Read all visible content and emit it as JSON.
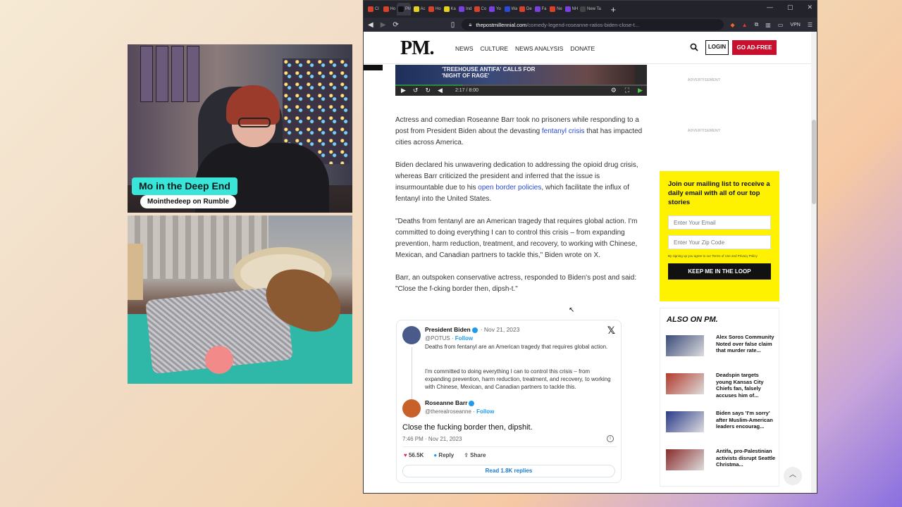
{
  "overlay": {
    "streamer_name": "Mo in the Deep End",
    "platform_tag": "Mointhedeep on Rumble"
  },
  "browser": {
    "tabs": [
      {
        "label": "Cl",
        "color": "#d9412b"
      },
      {
        "label": "Ho",
        "color": "#d9412b"
      },
      {
        "label": "PM",
        "color": "#111111",
        "active": true
      },
      {
        "label": "Ac",
        "color": "#e6d21a"
      },
      {
        "label": "Ho",
        "color": "#d9412b"
      },
      {
        "label": "Ka",
        "color": "#e6d21a"
      },
      {
        "label": "Ind",
        "color": "#7b3fe4"
      },
      {
        "label": "Co",
        "color": "#d9412b"
      },
      {
        "label": "Yo",
        "color": "#7b3fe4"
      },
      {
        "label": "Wa",
        "color": "#2a4bd8"
      },
      {
        "label": "De",
        "color": "#d9412b"
      },
      {
        "label": "Fa",
        "color": "#7b3fe4"
      },
      {
        "label": "Ne",
        "color": "#d9412b"
      },
      {
        "label": "NH",
        "color": "#7b3fe4"
      },
      {
        "label": "New Ta",
        "color": "#444444"
      }
    ],
    "new_tab": "+",
    "url_domain": "thepostmillennial.com",
    "url_path": "/comedy-legend-roseanne-ratios-biden-close-t...",
    "vpn": "VPN"
  },
  "site": {
    "logo": "PM.",
    "menu": [
      "NEWS",
      "CULTURE",
      "NEWS ANALYSIS",
      "DONATE"
    ],
    "login": "LOGIN",
    "adfree": "GO AD-FREE",
    "video": {
      "title_line1": "'TREEHOUSE ANTIFA' CALLS FOR",
      "title_line2": "'NIGHT OF RAGE'",
      "time": "2:17 / 8:00",
      "progress": 0.27
    },
    "article": {
      "p1_a": "Actress and comedian Roseanne Barr took no prisoners while responding to a post from President Biden about the devasting ",
      "p1_link": "fentanyl crisis",
      "p1_b": " that has impacted cities across America.",
      "p2_a": "Biden declared his unwavering dedication to addressing the opioid drug crisis, whereas Barr criticized the president and inferred that the issue is insurmountable due to his ",
      "p2_link": "open border policies",
      "p2_b": ", which facilitate the influx of fentanyl into the United States.",
      "p3": "\"Deaths from fentanyl are an American tragedy that requires global action. I'm committed to doing everything I can to control this crisis – from expanding prevention, harm reduction, treatment, and recovery, to working with Chinese, Mexican, and Canadian partners to tackle this,\" Biden wrote on X.",
      "p4": "Barr, an outspoken conservative actress, responded to Biden's post and said: \"Close the f-cking border then, dipsh-t.\""
    },
    "tweet": {
      "q_name": "President Biden",
      "q_date": "· Nov 21, 2023",
      "q_handle": "@POTUS · ",
      "q_follow": "Follow",
      "q_text1": "Deaths from fentanyl are an American tragedy that requires global action.",
      "q_text2": "I'm committed to doing everything I can to control this crisis – from expanding prevention, harm reduction, treatment, and recovery, to working with Chinese, Mexican, and Canadian partners to tackle this.",
      "r_name": "Roseanne Barr",
      "r_handle": "@therealroseanne · ",
      "r_follow": "Follow",
      "main_text": "Close the fucking border then, dipshit.",
      "meta": "7:46 PM · Nov 21, 2023",
      "likes": "56.5K",
      "reply": "Reply",
      "share": "Share",
      "read_replies": "Read 1.8K replies"
    },
    "sidebar": {
      "ad_label": "ADVERTISEMENT",
      "mail_title": "Join our mailing list to receive a daily email with all of our top stories",
      "email_placeholder": "Enter Your Email",
      "zip_placeholder": "Enter Your Zip Code",
      "fine_print": "By signing up you agree to our Terms of Use and Privacy Policy",
      "cta": "KEEP ME IN THE LOOP",
      "also_title": "ALSO ON PM.",
      "also_items": [
        {
          "text": "Alex Soros Community Noted over false claim that murder rate...",
          "color": "#3a4a7a"
        },
        {
          "text": "Deadspin targets young Kansas City Chiefs fan, falsely accuses him of...",
          "color": "#b23a2a"
        },
        {
          "text": "Biden says 'I'm sorry' after Muslim-American leaders encourag...",
          "color": "#2a3a8a"
        },
        {
          "text": "Antifa, pro-Palestinian activists disrupt Seattle Christma...",
          "color": "#8a2a2a"
        }
      ]
    }
  }
}
